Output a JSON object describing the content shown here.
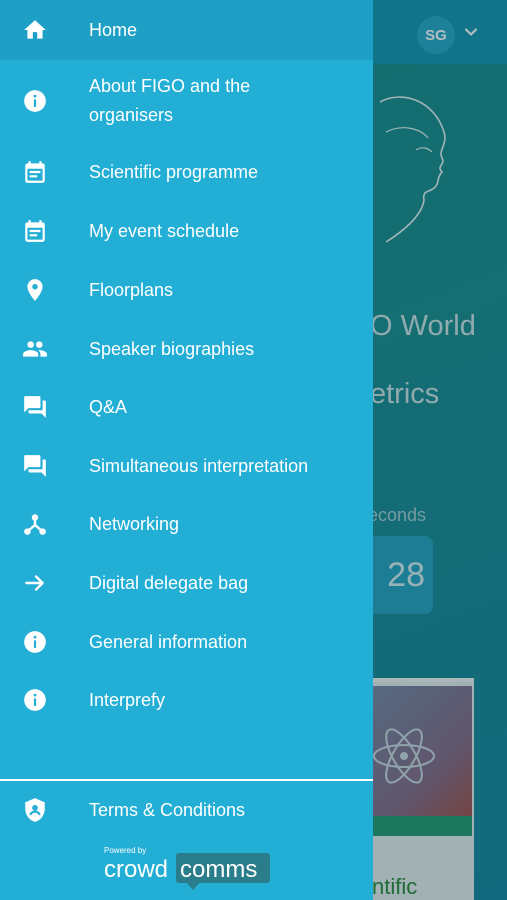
{
  "topbar": {
    "avatar_initials": "SG"
  },
  "background": {
    "title_line1": "O World",
    "title_line2": "etrics",
    "countdown_label": "econds",
    "countdown_value": "28",
    "card_text": "ntific"
  },
  "drawer": {
    "items": [
      {
        "label": "Home",
        "icon": "home-icon"
      },
      {
        "label": "About FIGO and the organisers",
        "icon": "info-icon"
      },
      {
        "label": "Scientific programme",
        "icon": "calendar-icon"
      },
      {
        "label": "My event schedule",
        "icon": "calendar-icon"
      },
      {
        "label": "Floorplans",
        "icon": "location-pin-icon"
      },
      {
        "label": "Speaker biographies",
        "icon": "people-icon"
      },
      {
        "label": "Q&A",
        "icon": "forum-icon"
      },
      {
        "label": "Simultaneous interpretation",
        "icon": "forum-icon"
      },
      {
        "label": "Networking",
        "icon": "network-icon"
      },
      {
        "label": "Digital delegate bag",
        "icon": "arrow-right-icon"
      },
      {
        "label": "General information",
        "icon": "info-icon"
      },
      {
        "label": "Interprefy",
        "icon": "info-icon"
      }
    ],
    "footer_item": {
      "label": "Terms & Conditions",
      "icon": "shield-icon"
    },
    "powered_by": "Powered by",
    "brand_crowd": "crowd",
    "brand_comms": "comms"
  },
  "colors": {
    "drawer_bg": "#22aed5",
    "drawer_active_bg": "#1e9fc6",
    "text": "#ffffff"
  }
}
